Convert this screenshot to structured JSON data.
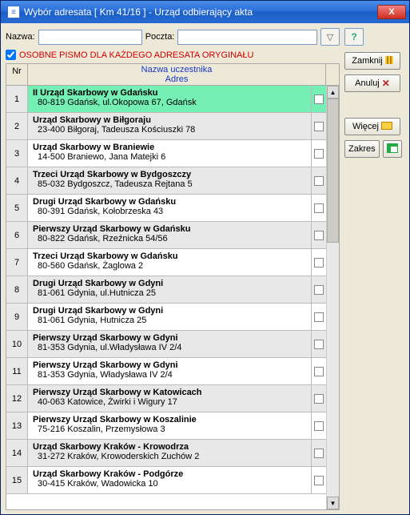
{
  "title": "Wybór adresata [ Km 41/16 ]  - Urząd odbierający akta",
  "labels": {
    "nazwa": "Nazwa:",
    "poczta": "Poczta:"
  },
  "inputs": {
    "nazwa_value": "",
    "poczta_value": ""
  },
  "checkbox_checked": true,
  "checkbox_label": "OSOBNE PISMO DLA KAŻDEGO ADRESATA ORYGINAŁU",
  "grid_header": {
    "nr": "Nr",
    "name": "Nazwa uczestnika",
    "addr": "Adres"
  },
  "buttons": {
    "zamknij": "Zamknij",
    "anuluj": "Anuluj",
    "wiecej": "Więcej",
    "zakres": "Zakres"
  },
  "rows": [
    {
      "nr": "1",
      "name": "II Urząd Skarbowy w Gdańsku",
      "addr": "80-819 Gdańsk, ul.Okopowa 67, Gdańsk",
      "sel": true
    },
    {
      "nr": "2",
      "name": "Urząd Skarbowy w Biłgoraju",
      "addr": "23-400 Biłgoraj, Tadeusza Kościuszki 78"
    },
    {
      "nr": "3",
      "name": "Urząd Skarbowy w Braniewie",
      "addr": "14-500 Braniewo, Jana Matejki 6"
    },
    {
      "nr": "4",
      "name": "Trzeci Urząd Skarbowy w Bydgoszczy",
      "addr": "85-032 Bydgoszcz, Tadeusza Rejtana 5"
    },
    {
      "nr": "5",
      "name": "Drugi Urząd Skarbowy w Gdańsku",
      "addr": "80-391 Gdańsk, Kołobrzeska 43"
    },
    {
      "nr": "6",
      "name": "Pierwszy Urząd Skarbowy w Gdańsku",
      "addr": "80-822 Gdańsk, Rzeźnicka 54/56"
    },
    {
      "nr": "7",
      "name": "Trzeci Urząd Skarbowy w Gdańsku",
      "addr": "80-560 Gdańsk, Żaglowa 2"
    },
    {
      "nr": "8",
      "name": "Drugi Urząd Skarbowy w Gdyni",
      "addr": "81-061 Gdynia, ul.Hutnicza 25"
    },
    {
      "nr": "9",
      "name": "Drugi Urząd Skarbowy w Gdyni",
      "addr": "81-061 Gdynia, Hutnicza 25"
    },
    {
      "nr": "10",
      "name": "Pierwszy Urząd Skarbowy w Gdyni",
      "addr": "81-353 Gdynia, ul.Władysława IV 2/4"
    },
    {
      "nr": "11",
      "name": "Pierwszy Urząd Skarbowy w Gdyni",
      "addr": "81-353 Gdynia, Władysława IV 2/4"
    },
    {
      "nr": "12",
      "name": "Pierwszy Urząd Skarbowy w Katowicach",
      "addr": "40-063 Katowice, Żwirki i Wigury 17"
    },
    {
      "nr": "13",
      "name": "Pierwszy Urząd Skarbowy w Koszalinie",
      "addr": "75-216 Koszalin, Przemysłowa 3"
    },
    {
      "nr": "14",
      "name": "Urząd Skarbowy Kraków - Krowodrza",
      "addr": "31-272 Kraków, Krowoderskich Zuchów 2"
    },
    {
      "nr": "15",
      "name": "Urząd Skarbowy Kraków - Podgórze",
      "addr": "30-415 Kraków, Wadowicka 10"
    }
  ]
}
